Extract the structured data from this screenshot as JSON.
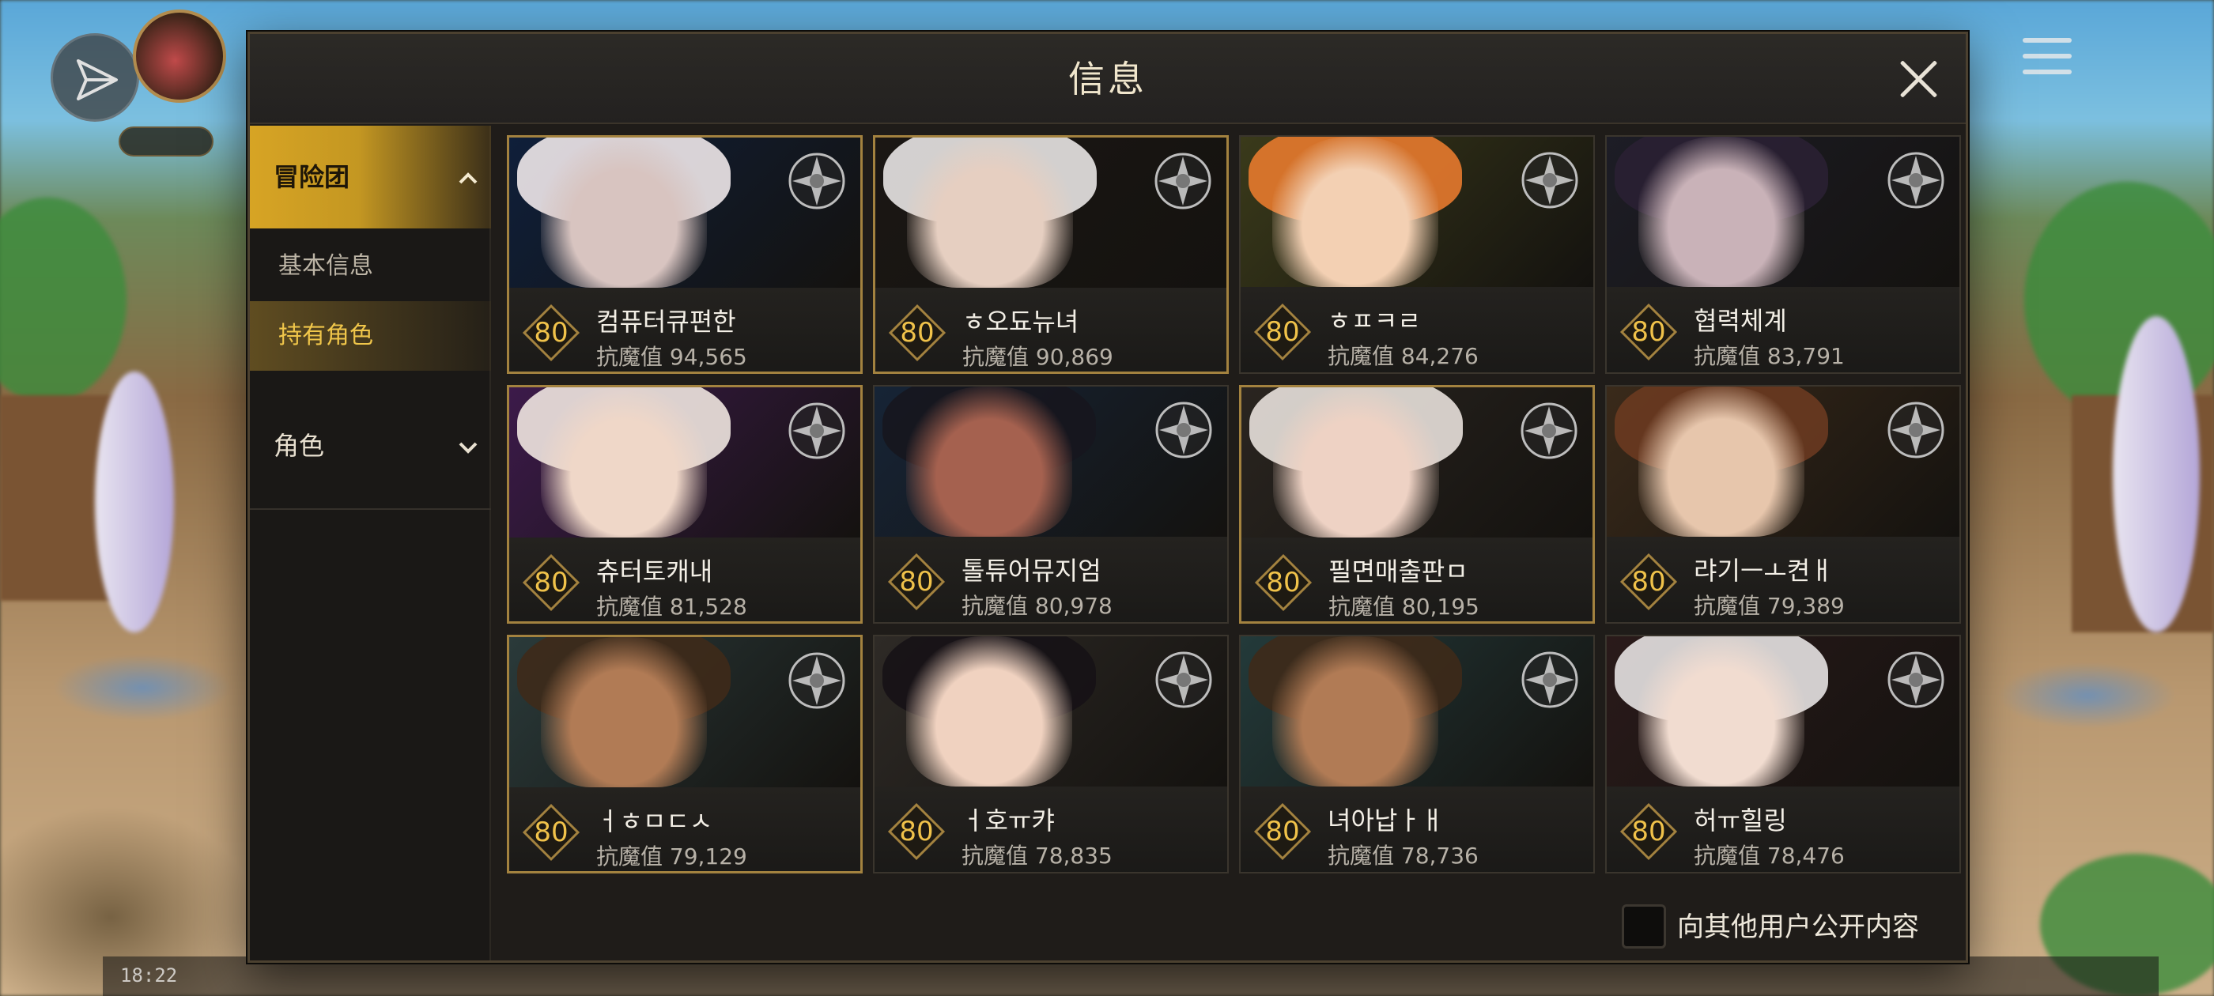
{
  "dialog": {
    "title": "信息",
    "public_toggle_label": "向其他用户公开内容",
    "public_toggle_checked": false
  },
  "sidebar": {
    "categories": [
      {
        "label": "冒险团",
        "expanded": true,
        "active": true
      },
      {
        "label": "角色",
        "expanded": false,
        "active": false
      }
    ],
    "subitems": [
      {
        "label": "基本信息",
        "active": false
      },
      {
        "label": "持有角色",
        "active": true
      }
    ]
  },
  "hud": {
    "time": "18:22"
  },
  "characters": [
    {
      "level": "80",
      "name": "컴퓨터큐편한",
      "power": "抗魔值 94,565",
      "gold_frame": true
    },
    {
      "level": "80",
      "name": "ㅎ오됴뉴녀",
      "power": "抗魔值 90,869",
      "gold_frame": true
    },
    {
      "level": "80",
      "name": "ㅎㅍㅋㄹ",
      "power": "抗魔值 84,276",
      "gold_frame": false
    },
    {
      "level": "80",
      "name": "협력체계",
      "power": "抗魔值 83,791",
      "gold_frame": false
    },
    {
      "level": "80",
      "name": "츄터토캐내",
      "power": "抗魔值 81,528",
      "gold_frame": true
    },
    {
      "level": "80",
      "name": "톨튜어뮤지엄",
      "power": "抗魔值 80,978",
      "gold_frame": false
    },
    {
      "level": "80",
      "name": "필면매출판ㅁ",
      "power": "抗魔值 80,195",
      "gold_frame": true
    },
    {
      "level": "80",
      "name": "랴기ㅡㅗ켠ㅐ",
      "power": "抗魔值 79,389",
      "gold_frame": false
    },
    {
      "level": "80",
      "name": "ㅓㅎㅁㄷㅅ",
      "power": "抗魔值 79,129",
      "gold_frame": true
    },
    {
      "level": "80",
      "name": "ㅓ호ㅠ캬",
      "power": "抗魔值 78,835",
      "gold_frame": false
    },
    {
      "level": "80",
      "name": "녀아납ㅏㅐ",
      "power": "抗魔值 78,736",
      "gold_frame": false
    },
    {
      "level": "80",
      "name": "허ㅠ힐링",
      "power": "抗魔值 78,476",
      "gold_frame": false
    }
  ],
  "colors": {
    "accent_gold": "#d7a424",
    "level_text": "#f0c24a",
    "panel_bg": "#1f1c19"
  }
}
